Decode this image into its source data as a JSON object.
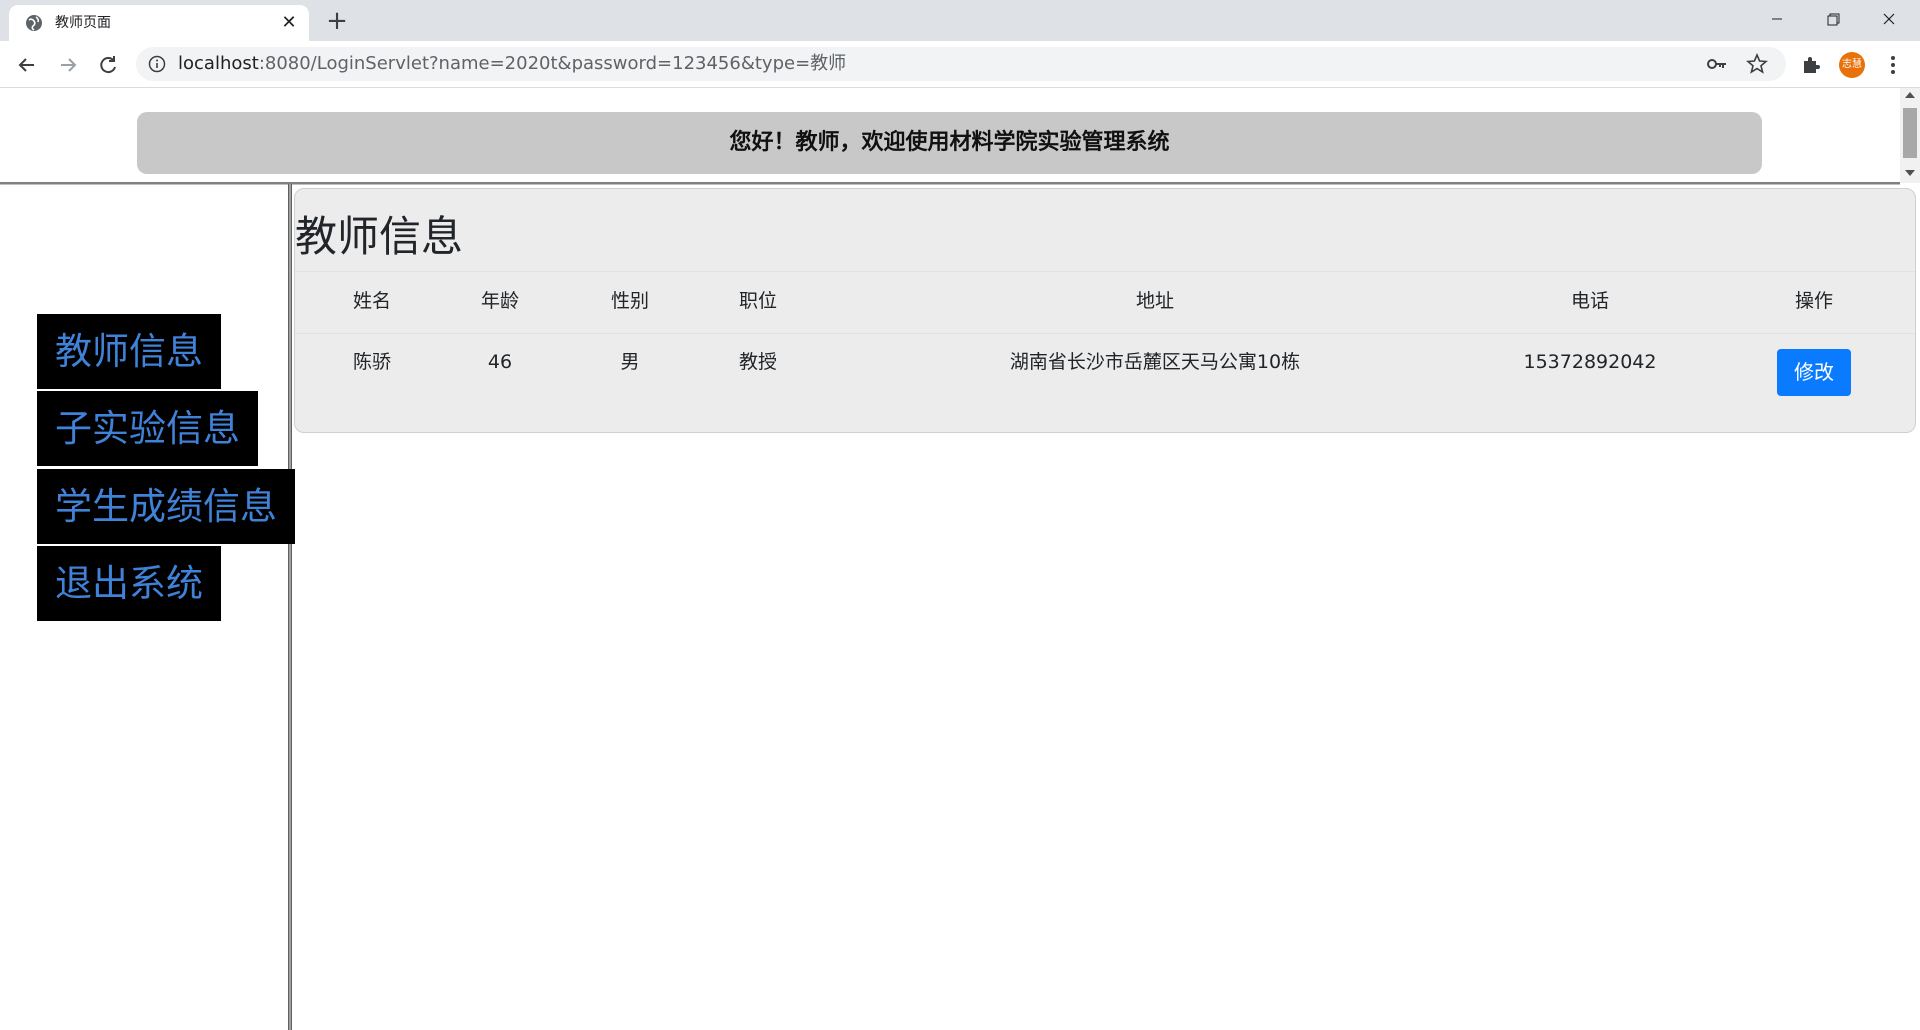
{
  "browser": {
    "tab_title": "教师页面",
    "url_host": "localhost",
    "url_rest": ":8080/LoginServlet?name=2020t&password=123456&type=教师",
    "profile_label": "志慧"
  },
  "page": {
    "welcome": "您好！教师，欢迎使用材料学院实验管理系统",
    "menu": [
      {
        "label": "教师信息"
      },
      {
        "label": "子实验信息"
      },
      {
        "label": "学生成绩信息"
      },
      {
        "label": "退出系统"
      }
    ],
    "panel_title": "教师信息",
    "table": {
      "headers": [
        "姓名",
        "年龄",
        "性别",
        "职位",
        "地址",
        "电话",
        "操作"
      ],
      "rows": [
        {
          "name": "陈骄",
          "age": "46",
          "gender": "男",
          "position": "教授",
          "address": "湖南省长沙市岳麓区天马公寓10栋",
          "phone": "15372892042",
          "action_label": "修改"
        }
      ]
    }
  },
  "colors": {
    "menu_bg": "#000000",
    "menu_text": "#3f82d8",
    "banner_bg": "#c8c8c8",
    "panel_bg": "#ececec",
    "button_bg": "#0a7bff"
  }
}
